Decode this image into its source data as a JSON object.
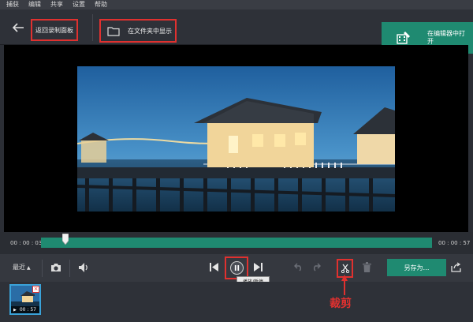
{
  "menu": [
    "捕获",
    "编辑",
    "共享",
    "设置",
    "帮助"
  ],
  "toolbar": {
    "back_to_panel_label": "返回录制面板",
    "show_in_folder_label": "在文件夹中显示",
    "open_in_editor_label": "在编辑器中打开"
  },
  "timeline": {
    "current_time": "00 : 00 : 03",
    "total_time": "00 : 00 : 57",
    "progress": 0.053
  },
  "controls": {
    "recent_label": "最近",
    "save_as_label": "另存为…",
    "pause_tooltip": "播放/暂停"
  },
  "thumbnail": {
    "duration": "00 : 57"
  },
  "annotation": {
    "label": "裁剪"
  },
  "icons": {
    "back": "back-arrow-icon",
    "folder": "folder-icon",
    "editor": "film-edit-icon",
    "camera": "camera-icon",
    "volume": "volume-icon",
    "prev": "skip-previous-icon",
    "pause": "pause-icon",
    "next": "skip-next-icon",
    "undo": "undo-icon",
    "redo": "redo-icon",
    "cut": "scissors-icon",
    "trash": "trash-icon",
    "share": "share-icon"
  },
  "colors": {
    "accent": "#1f8a71",
    "highlight": "#e0312f",
    "thumb_border": "#3aa2d8"
  }
}
